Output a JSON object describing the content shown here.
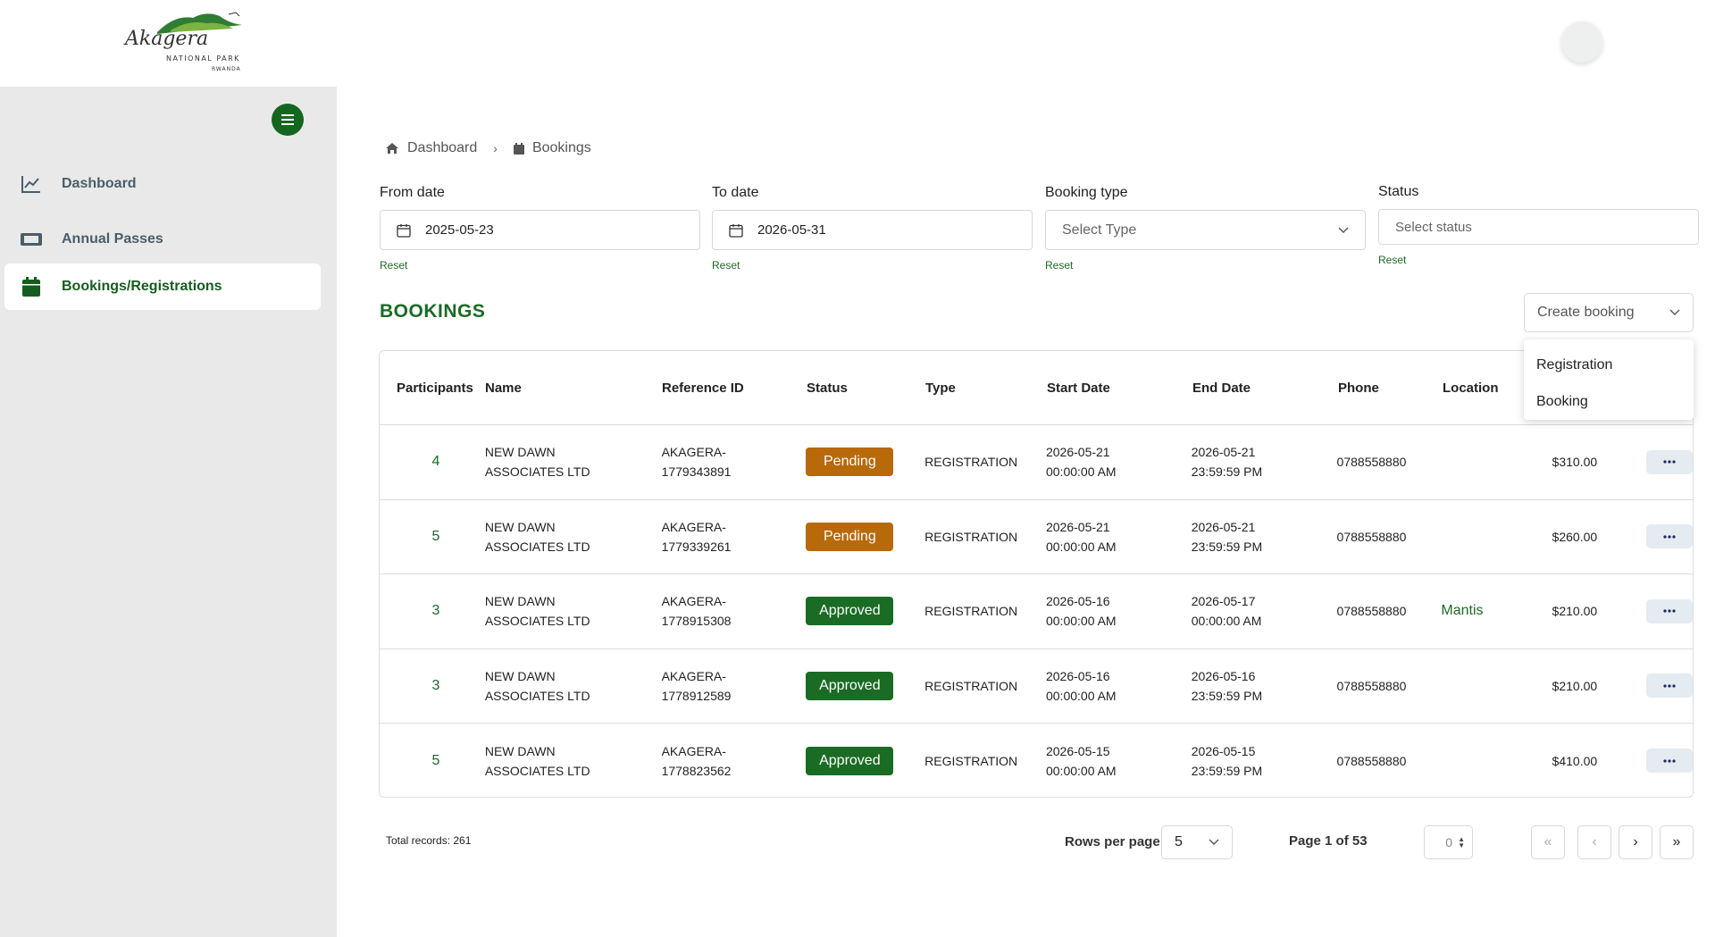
{
  "header": {
    "logo_text": "Akagera",
    "logo_subtitle": "NATIONAL PARK",
    "logo_country": "RWANDA"
  },
  "sidebar": {
    "items": [
      {
        "label": "Dashboard",
        "icon": "chart-line-icon"
      },
      {
        "label": "Annual Passes",
        "icon": "ticket-icon"
      },
      {
        "label": "Bookings/Registrations",
        "icon": "calendar-icon",
        "active": true
      }
    ]
  },
  "breadcrumb": {
    "home": "Dashboard",
    "current": "Bookings"
  },
  "filters": {
    "from_date": {
      "label": "From date",
      "value": "2025-05-23",
      "reset": "Reset"
    },
    "to_date": {
      "label": "To date",
      "value": "2026-05-31",
      "reset": "Reset"
    },
    "booking_type": {
      "label": "Booking type",
      "placeholder": "Select Type",
      "reset": "Reset"
    },
    "status": {
      "label": "Status",
      "placeholder": "Select status",
      "reset": "Reset"
    }
  },
  "section_title": "BOOKINGS",
  "create_booking": {
    "label": "Create booking",
    "options": [
      "Registration",
      "Booking"
    ]
  },
  "table": {
    "columns": [
      "Participants",
      "Name",
      "Reference ID",
      "Status",
      "Type",
      "Start Date",
      "End Date",
      "Phone",
      "Location"
    ],
    "rows": [
      {
        "participants": "4",
        "name1": "NEW DAWN",
        "name2": "ASSOCIATES LTD",
        "ref1": "AKAGERA-",
        "ref2": "1779343891",
        "status": "Pending",
        "type": "REGISTRATION",
        "start1": "2026-05-21",
        "start2": "00:00:00 AM",
        "end1": "2026-05-21",
        "end2": "23:59:59 PM",
        "phone": "0788558880",
        "location": "",
        "amount": "$310.00"
      },
      {
        "participants": "5",
        "name1": "NEW DAWN",
        "name2": "ASSOCIATES LTD",
        "ref1": "AKAGERA-",
        "ref2": "1779339261",
        "status": "Pending",
        "type": "REGISTRATION",
        "start1": "2026-05-21",
        "start2": "00:00:00 AM",
        "end1": "2026-05-21",
        "end2": "23:59:59 PM",
        "phone": "0788558880",
        "location": "",
        "amount": "$260.00"
      },
      {
        "participants": "3",
        "name1": "NEW DAWN",
        "name2": "ASSOCIATES LTD",
        "ref1": "AKAGERA-",
        "ref2": "1778915308",
        "status": "Approved",
        "type": "REGISTRATION",
        "start1": "2026-05-16",
        "start2": "00:00:00 AM",
        "end1": "2026-05-17",
        "end2": "00:00:00 AM",
        "phone": "0788558880",
        "location": "Mantis",
        "amount": "$210.00"
      },
      {
        "participants": "3",
        "name1": "NEW DAWN",
        "name2": "ASSOCIATES LTD",
        "ref1": "AKAGERA-",
        "ref2": "1778912589",
        "status": "Approved",
        "type": "REGISTRATION",
        "start1": "2026-05-16",
        "start2": "00:00:00 AM",
        "end1": "2026-05-16",
        "end2": "23:59:59 PM",
        "phone": "0788558880",
        "location": "",
        "amount": "$210.00"
      },
      {
        "participants": "5",
        "name1": "NEW DAWN",
        "name2": "ASSOCIATES LTD",
        "ref1": "AKAGERA-",
        "ref2": "1778823562",
        "status": "Approved",
        "type": "REGISTRATION",
        "start1": "2026-05-15",
        "start2": "00:00:00 AM",
        "end1": "2026-05-15",
        "end2": "23:59:59 PM",
        "phone": "0788558880",
        "location": "",
        "amount": "$410.00"
      }
    ]
  },
  "pagination": {
    "total": "Total records: 261",
    "rows_per_page_label": "Rows per page",
    "rows_per_page": "5",
    "page_info": "Page 1 of 53",
    "page_input": "0"
  },
  "colors": {
    "brand_green": "#1a6b24",
    "pending": "#b8690a",
    "approved": "#1a6b24"
  }
}
